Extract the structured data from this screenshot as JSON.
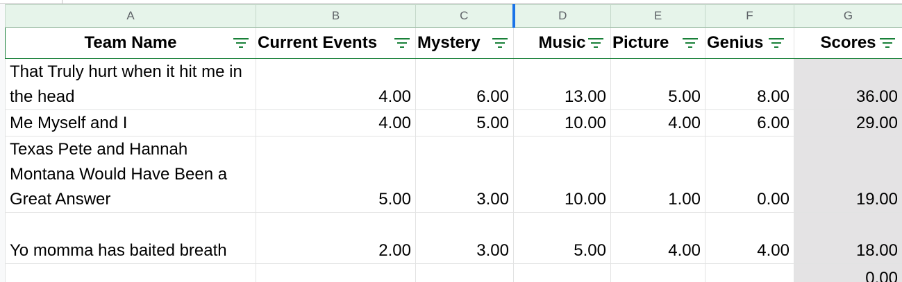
{
  "columns": [
    "A",
    "B",
    "C",
    "D",
    "E",
    "F",
    "G"
  ],
  "headers": [
    "Team Name",
    "Current Events",
    "Mystery",
    "Music",
    "Picture",
    "Genius",
    "Scores"
  ],
  "rows": [
    {
      "team": "That Truly hurt when it hit me in the head",
      "values": [
        "4.00",
        "6.00",
        "13.00",
        "5.00",
        "8.00"
      ],
      "score": "36.00"
    },
    {
      "team": "Me Myself and I",
      "values": [
        "4.00",
        "5.00",
        "10.00",
        "4.00",
        "6.00"
      ],
      "score": "29.00"
    },
    {
      "team": "Texas Pete and Hannah Montana Would Have Been a Great Answer",
      "values": [
        "5.00",
        "3.00",
        "10.00",
        "1.00",
        "0.00"
      ],
      "score": "19.00"
    },
    {
      "team": "Yo momma has baited breath",
      "values": [
        "2.00",
        "3.00",
        "5.00",
        "4.00",
        "4.00"
      ],
      "score": "18.00"
    },
    {
      "team": "",
      "values": [
        "",
        "",
        "",
        "",
        ""
      ],
      "score": "0.00"
    }
  ],
  "icons": {
    "filter": "filter-icon"
  },
  "colors": {
    "filter_green": "#188038",
    "column_header_bg": "#e6f4ea",
    "score_bg": "#e4e3e4",
    "selection_blue": "#1a73e8"
  }
}
